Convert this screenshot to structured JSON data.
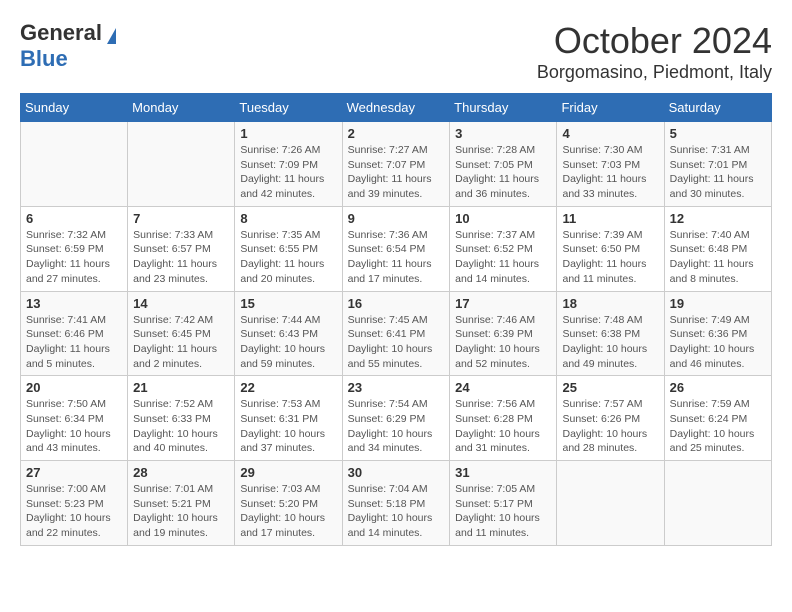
{
  "header": {
    "logo_general": "General",
    "logo_blue": "Blue",
    "month": "October 2024",
    "location": "Borgomasino, Piedmont, Italy"
  },
  "days_of_week": [
    "Sunday",
    "Monday",
    "Tuesday",
    "Wednesday",
    "Thursday",
    "Friday",
    "Saturday"
  ],
  "weeks": [
    [
      {
        "day": "",
        "info": ""
      },
      {
        "day": "",
        "info": ""
      },
      {
        "day": "1",
        "info": "Sunrise: 7:26 AM\nSunset: 7:09 PM\nDaylight: 11 hours and 42 minutes."
      },
      {
        "day": "2",
        "info": "Sunrise: 7:27 AM\nSunset: 7:07 PM\nDaylight: 11 hours and 39 minutes."
      },
      {
        "day": "3",
        "info": "Sunrise: 7:28 AM\nSunset: 7:05 PM\nDaylight: 11 hours and 36 minutes."
      },
      {
        "day": "4",
        "info": "Sunrise: 7:30 AM\nSunset: 7:03 PM\nDaylight: 11 hours and 33 minutes."
      },
      {
        "day": "5",
        "info": "Sunrise: 7:31 AM\nSunset: 7:01 PM\nDaylight: 11 hours and 30 minutes."
      }
    ],
    [
      {
        "day": "6",
        "info": "Sunrise: 7:32 AM\nSunset: 6:59 PM\nDaylight: 11 hours and 27 minutes."
      },
      {
        "day": "7",
        "info": "Sunrise: 7:33 AM\nSunset: 6:57 PM\nDaylight: 11 hours and 23 minutes."
      },
      {
        "day": "8",
        "info": "Sunrise: 7:35 AM\nSunset: 6:55 PM\nDaylight: 11 hours and 20 minutes."
      },
      {
        "day": "9",
        "info": "Sunrise: 7:36 AM\nSunset: 6:54 PM\nDaylight: 11 hours and 17 minutes."
      },
      {
        "day": "10",
        "info": "Sunrise: 7:37 AM\nSunset: 6:52 PM\nDaylight: 11 hours and 14 minutes."
      },
      {
        "day": "11",
        "info": "Sunrise: 7:39 AM\nSunset: 6:50 PM\nDaylight: 11 hours and 11 minutes."
      },
      {
        "day": "12",
        "info": "Sunrise: 7:40 AM\nSunset: 6:48 PM\nDaylight: 11 hours and 8 minutes."
      }
    ],
    [
      {
        "day": "13",
        "info": "Sunrise: 7:41 AM\nSunset: 6:46 PM\nDaylight: 11 hours and 5 minutes."
      },
      {
        "day": "14",
        "info": "Sunrise: 7:42 AM\nSunset: 6:45 PM\nDaylight: 11 hours and 2 minutes."
      },
      {
        "day": "15",
        "info": "Sunrise: 7:44 AM\nSunset: 6:43 PM\nDaylight: 10 hours and 59 minutes."
      },
      {
        "day": "16",
        "info": "Sunrise: 7:45 AM\nSunset: 6:41 PM\nDaylight: 10 hours and 55 minutes."
      },
      {
        "day": "17",
        "info": "Sunrise: 7:46 AM\nSunset: 6:39 PM\nDaylight: 10 hours and 52 minutes."
      },
      {
        "day": "18",
        "info": "Sunrise: 7:48 AM\nSunset: 6:38 PM\nDaylight: 10 hours and 49 minutes."
      },
      {
        "day": "19",
        "info": "Sunrise: 7:49 AM\nSunset: 6:36 PM\nDaylight: 10 hours and 46 minutes."
      }
    ],
    [
      {
        "day": "20",
        "info": "Sunrise: 7:50 AM\nSunset: 6:34 PM\nDaylight: 10 hours and 43 minutes."
      },
      {
        "day": "21",
        "info": "Sunrise: 7:52 AM\nSunset: 6:33 PM\nDaylight: 10 hours and 40 minutes."
      },
      {
        "day": "22",
        "info": "Sunrise: 7:53 AM\nSunset: 6:31 PM\nDaylight: 10 hours and 37 minutes."
      },
      {
        "day": "23",
        "info": "Sunrise: 7:54 AM\nSunset: 6:29 PM\nDaylight: 10 hours and 34 minutes."
      },
      {
        "day": "24",
        "info": "Sunrise: 7:56 AM\nSunset: 6:28 PM\nDaylight: 10 hours and 31 minutes."
      },
      {
        "day": "25",
        "info": "Sunrise: 7:57 AM\nSunset: 6:26 PM\nDaylight: 10 hours and 28 minutes."
      },
      {
        "day": "26",
        "info": "Sunrise: 7:59 AM\nSunset: 6:24 PM\nDaylight: 10 hours and 25 minutes."
      }
    ],
    [
      {
        "day": "27",
        "info": "Sunrise: 7:00 AM\nSunset: 5:23 PM\nDaylight: 10 hours and 22 minutes."
      },
      {
        "day": "28",
        "info": "Sunrise: 7:01 AM\nSunset: 5:21 PM\nDaylight: 10 hours and 19 minutes."
      },
      {
        "day": "29",
        "info": "Sunrise: 7:03 AM\nSunset: 5:20 PM\nDaylight: 10 hours and 17 minutes."
      },
      {
        "day": "30",
        "info": "Sunrise: 7:04 AM\nSunset: 5:18 PM\nDaylight: 10 hours and 14 minutes."
      },
      {
        "day": "31",
        "info": "Sunrise: 7:05 AM\nSunset: 5:17 PM\nDaylight: 10 hours and 11 minutes."
      },
      {
        "day": "",
        "info": ""
      },
      {
        "day": "",
        "info": ""
      }
    ]
  ]
}
